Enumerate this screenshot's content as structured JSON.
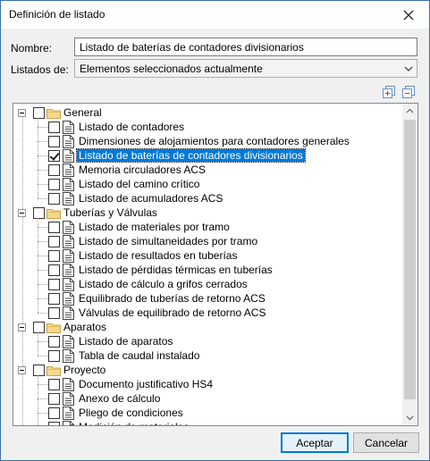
{
  "window": {
    "title": "Definición de listado"
  },
  "form": {
    "name_label": "Nombre:",
    "name_value": "Listado de baterías de contadores divisionarios",
    "listados_label": "Listados de:",
    "listados_value": "Elementos seleccionados actualmente"
  },
  "toolbar": {
    "expand_icon": "expand-all-icon",
    "collapse_icon": "collapse-all-icon"
  },
  "tree": [
    {
      "label": "General",
      "type": "folder",
      "children": [
        {
          "label": "Listado de contadores",
          "checked": false
        },
        {
          "label": "Dimensiones de alojamientos para contadores generales",
          "checked": false
        },
        {
          "label": "Listado de baterías de contadores divisionarios",
          "checked": true,
          "selected": true
        },
        {
          "label": "Memoria circuladores ACS",
          "checked": false
        },
        {
          "label": "Listado del camino crítico",
          "checked": false
        },
        {
          "label": "Listado de acumuladores ACS",
          "checked": false
        }
      ]
    },
    {
      "label": "Tuberías y Válvulas",
      "type": "folder",
      "children": [
        {
          "label": "Listado de materiales por tramo",
          "checked": false
        },
        {
          "label": "Listado de simultaneidades por tramo",
          "checked": false
        },
        {
          "label": "Listado de resultados en tuberías",
          "checked": false
        },
        {
          "label": "Listado de pérdidas térmicas en tuberías",
          "checked": false
        },
        {
          "label": "Listado de cálculo a grifos cerrados",
          "checked": false
        },
        {
          "label": "Equilibrado de tuberías de retorno ACS",
          "checked": false
        },
        {
          "label": "Válvulas de equilibrado de retorno ACS",
          "checked": false
        }
      ]
    },
    {
      "label": "Aparatos",
      "type": "folder",
      "children": [
        {
          "label": "Listado de aparatos",
          "checked": false
        },
        {
          "label": "Tabla de caudal instalado",
          "checked": false
        }
      ]
    },
    {
      "label": "Proyecto",
      "type": "folder",
      "children": [
        {
          "label": "Documento justificativo HS4",
          "checked": false
        },
        {
          "label": "Anexo de cálculo",
          "checked": false
        },
        {
          "label": "Pliego de condiciones",
          "checked": false
        },
        {
          "label": "Medición de materiales",
          "checked": false
        }
      ]
    }
  ],
  "buttons": {
    "accept": "Aceptar",
    "cancel": "Cancelar"
  }
}
